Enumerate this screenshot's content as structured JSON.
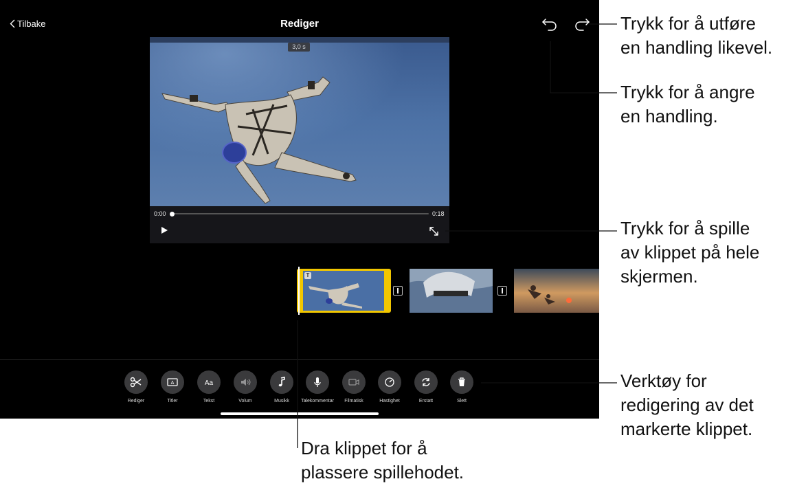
{
  "nav": {
    "back_label": "Tilbake",
    "title": "Rediger"
  },
  "viewer": {
    "duration_badge": "3,0 s",
    "time_start": "0:00",
    "time_end": "0:18",
    "playhead_progress": 0.0
  },
  "timeline": {
    "clips": [
      "skydiver-clip-selected",
      "parachute-clip",
      "sunset-skydivers-clip"
    ]
  },
  "tools": [
    {
      "label": "Rediger",
      "icon": "scissors-icon"
    },
    {
      "label": "Titler",
      "icon": "titles-icon"
    },
    {
      "label": "Tekst",
      "icon": "text-icon"
    },
    {
      "label": "Volum",
      "icon": "volume-icon"
    },
    {
      "label": "Musikk",
      "icon": "music-icon"
    },
    {
      "label": "Talekommentar",
      "icon": "microphone-icon"
    },
    {
      "label": "Filmatisk",
      "icon": "cinematic-camera-icon"
    },
    {
      "label": "Hastighet",
      "icon": "speed-gauge-icon"
    },
    {
      "label": "Erstatt",
      "icon": "replace-icon"
    },
    {
      "label": "Slett",
      "icon": "trash-icon"
    }
  ],
  "callouts": {
    "redo": [
      "Trykk for å utføre",
      "en handling likevel."
    ],
    "undo": [
      "Trykk for å angre",
      "en handling."
    ],
    "fullscreen": [
      "Trykk for å spille",
      "av klippet på hele",
      "skjermen."
    ],
    "tools": [
      "Verktøy for",
      "redigering av det",
      "markerte klippet."
    ],
    "drag": [
      "Dra klippet for å",
      "plassere spillehodet."
    ]
  },
  "colors": {
    "selection": "#f2c700",
    "background": "#000000",
    "tool_button": "#3a3a3c"
  }
}
